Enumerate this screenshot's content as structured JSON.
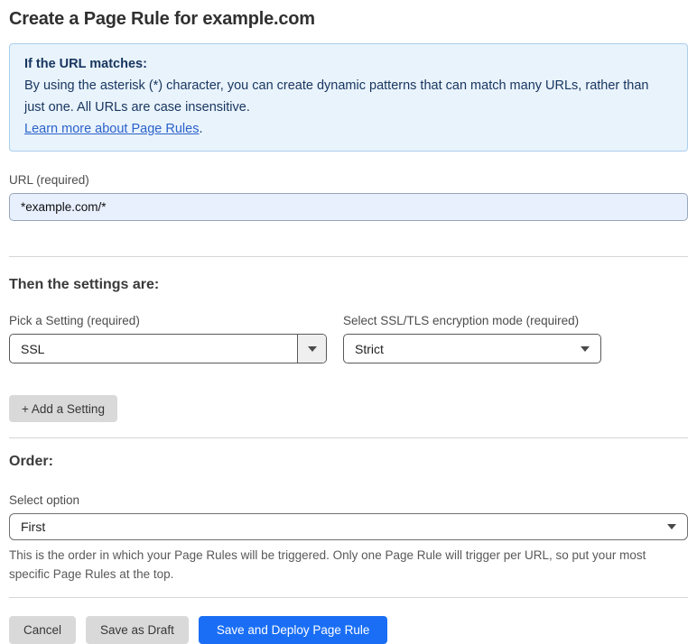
{
  "page": {
    "title": "Create a Page Rule for example.com"
  },
  "info_box": {
    "heading": "If the URL matches:",
    "body": "By using the asterisk (*) character, you can create dynamic patterns that can match many URLs, rather than just one. All URLs are case insensitive.",
    "link_label": "Learn more about Page Rules",
    "link_suffix": "."
  },
  "url_field": {
    "label": "URL (required)",
    "value": "*example.com/*"
  },
  "settings_section": {
    "heading": "Then the settings are:",
    "setting_picker": {
      "label": "Pick a Setting (required)",
      "selected": "SSL"
    },
    "ssl_mode_picker": {
      "label": "Select SSL/TLS encryption mode (required)",
      "selected": "Strict"
    },
    "add_setting_label": "+ Add a Setting"
  },
  "order_section": {
    "heading": "Order:",
    "select_label": "Select option",
    "selected": "First",
    "help_text": "This is the order in which your Page Rules will be triggered. Only one Page Rule will trigger per URL, so put your most specific Page Rules at the top."
  },
  "actions": {
    "cancel_label": "Cancel",
    "save_draft_label": "Save as Draft",
    "save_deploy_label": "Save and Deploy Page Rule"
  },
  "colors": {
    "info_box_bg": "#e9f3fc",
    "info_box_border": "#a9cfee",
    "info_text": "#17355e",
    "link_blue": "#2b62ca",
    "url_input_bg": "#e8f0fe",
    "gray_button_bg": "#d9d9d9",
    "primary_button_bg": "#1a6ef5",
    "divider": "#d6d6d6"
  }
}
